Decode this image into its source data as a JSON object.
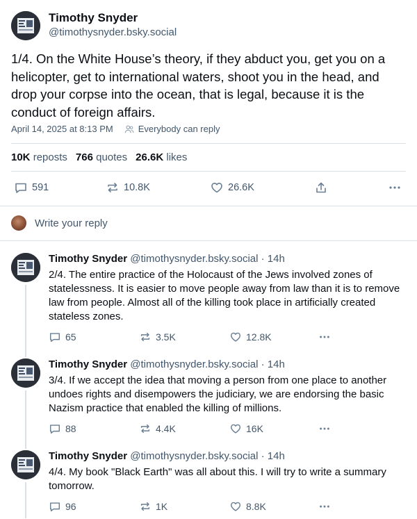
{
  "post": {
    "author_name": "Timothy Snyder",
    "author_handle": "@timothysnyder.bsky.social",
    "text": "1/4. On the White House’s theory, if they abduct you, get you on a helicopter, get to international waters, shoot you in the head, and drop your corpse into the ocean, that is legal, because it is the conduct of foreign affairs.",
    "timestamp": "April 14, 2025 at 8:13 PM",
    "reply_setting": "Everybody can reply",
    "stats": {
      "reposts_count": "10K",
      "reposts_label": "reposts",
      "quotes_count": "766",
      "quotes_label": "quotes",
      "likes_count": "26.6K",
      "likes_label": "likes"
    },
    "actions": {
      "replies": "591",
      "reposts": "10.8K",
      "likes": "26.6K"
    }
  },
  "reply_prompt": "Write your reply",
  "thread": [
    {
      "author_name": "Timothy Snyder",
      "author_handle": "@timothysnyder.bsky.social · 14h",
      "text": "2/4. The entire practice of the Holocaust of the Jews involved zones of statelessness. It is easier to move people away from law than it is to remove law from people. Almost all of the killing took place in artificially created stateless zones.",
      "replies": "65",
      "reposts": "3.5K",
      "likes": "12.8K"
    },
    {
      "author_name": "Timothy Snyder",
      "author_handle": "@timothysnyder.bsky.social · 14h",
      "text": "3/4. If we accept the idea that moving a person from one place to another undoes rights and disempowers the judiciary, we are endorsing the basic Nazism practice that enabled the killing of millions.",
      "replies": "88",
      "reposts": "4.4K",
      "likes": "16K"
    },
    {
      "author_name": "Timothy Snyder",
      "author_handle": "@timothysnyder.bsky.social · 14h",
      "text": "4/4. My book \"Black Earth\" was all about this. I will try to write a summary tomorrow.",
      "replies": "96",
      "reposts": "1K",
      "likes": "8.8K"
    }
  ],
  "icons": {
    "reply": "reply-bubble-icon",
    "repost": "repost-icon",
    "like": "heart-icon",
    "share": "share-icon",
    "more": "more-dots-icon",
    "audience": "people-icon"
  },
  "colors": {
    "text_primary": "#0b0f14",
    "text_secondary": "#42576c",
    "divider": "#d8e0e8"
  }
}
